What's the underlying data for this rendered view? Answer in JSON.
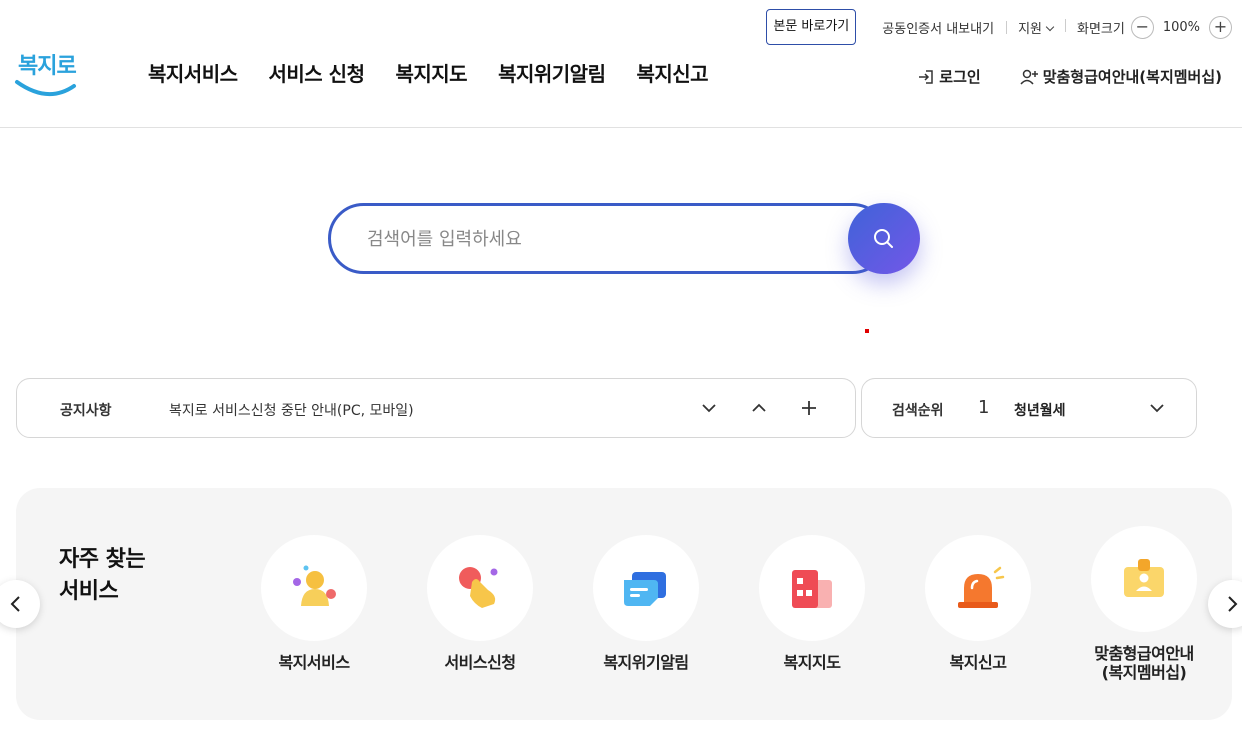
{
  "utility": {
    "skip_link": "본문 바로가기",
    "cert_export": "공동인증서 내보내기",
    "support": "지원",
    "zoom_label": "화면크기",
    "zoom_value": "100%"
  },
  "logo": {
    "text": "복지로"
  },
  "gnb": {
    "items": [
      {
        "label": "복지서비스"
      },
      {
        "label": "서비스 신청"
      },
      {
        "label": "복지지도"
      },
      {
        "label": "복지위기알림"
      },
      {
        "label": "복지신고"
      }
    ]
  },
  "member": {
    "login": "로그인",
    "membership": "맞춤형급여안내(복지멤버십)"
  },
  "search": {
    "placeholder": "검색어를 입력하세요"
  },
  "notice": {
    "label": "공지사항",
    "text": "복지로 서비스신청 중단 안내(PC, 모바일)"
  },
  "ranking": {
    "label": "검색순위",
    "rank": "1",
    "keyword": "청년월세"
  },
  "frequent": {
    "title_line1": "자주 찾는",
    "title_line2": "서비스",
    "services": [
      {
        "label": "복지서비스",
        "icon": "person-icon"
      },
      {
        "label": "서비스신청",
        "icon": "hand-tap-icon"
      },
      {
        "label": "복지위기알림",
        "icon": "message-icon"
      },
      {
        "label": "복지지도",
        "icon": "map-blocks-icon"
      },
      {
        "label": "복지신고",
        "icon": "siren-icon"
      },
      {
        "label_line1": "맞춤형급여안내",
        "label_line2": "(복지멤버십)",
        "icon": "id-card-icon"
      }
    ]
  },
  "colors": {
    "accent_blue": "#3a5bc7",
    "search_gradient_start": "#3f63d8",
    "search_gradient_end": "#7357e8",
    "logo_blue": "#2aa2dc"
  }
}
